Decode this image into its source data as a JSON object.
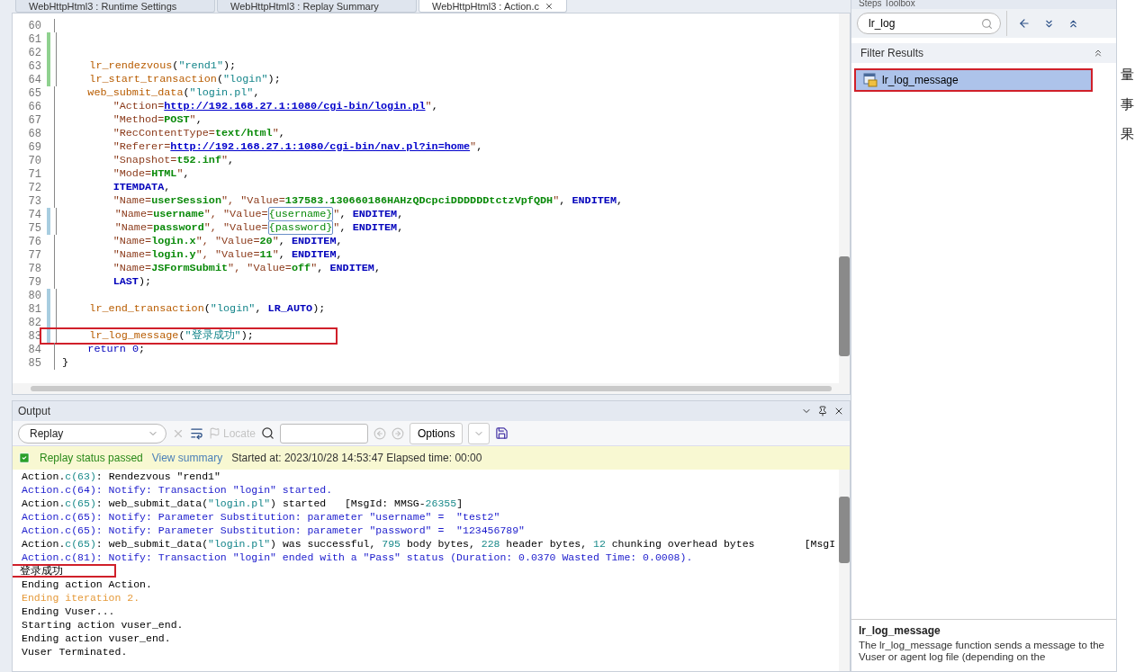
{
  "tabs": [
    {
      "label": "WebHttpHtml3 : Runtime Settings",
      "selected": false,
      "closable": false
    },
    {
      "label": "WebHttpHtml3 : Replay Summary",
      "selected": false,
      "closable": false
    },
    {
      "label": "WebHttpHtml3 : Action.c",
      "selected": true,
      "closable": true
    }
  ],
  "code": {
    "lines": [
      {
        "number": "60"
      },
      {
        "number": "61",
        "color": "#8fd18f"
      },
      {
        "number": "62",
        "color": "#8fd18f"
      },
      {
        "number": "63",
        "color": "#8fd18f",
        "tokens": [
          {
            "kind": "fn",
            "text": "    lr_rendezvous"
          },
          {
            "kind": "plain",
            "text": "("
          },
          {
            "kind": "str",
            "text": "\"rend1\""
          },
          {
            "kind": "plain",
            "text": ");"
          }
        ]
      },
      {
        "number": "64",
        "color": "#8fd18f",
        "tokens": [
          {
            "kind": "fn",
            "text": "    lr_start_transaction"
          },
          {
            "kind": "plain",
            "text": "("
          },
          {
            "kind": "str",
            "text": "\"login\""
          },
          {
            "kind": "plain",
            "text": ");"
          }
        ]
      },
      {
        "number": "65",
        "tokens": [
          {
            "kind": "fn",
            "text": "    web_submit_data"
          },
          {
            "kind": "plain",
            "text": "("
          },
          {
            "kind": "str",
            "text": "\"login.pl\""
          },
          {
            "kind": "plain",
            "text": ","
          }
        ]
      },
      {
        "number": "66",
        "tokens": [
          {
            "kind": "key",
            "text": "        \"Action="
          },
          {
            "kind": "link",
            "text": "http://192.168.27.1:1080/cgi-bin/login.pl"
          },
          {
            "kind": "key",
            "text": "\""
          },
          {
            "kind": "plain",
            "text": ","
          }
        ]
      },
      {
        "number": "67",
        "tokens": [
          {
            "kind": "key",
            "text": "        \"Method="
          },
          {
            "kind": "val",
            "text": "POST"
          },
          {
            "kind": "key",
            "text": "\""
          },
          {
            "kind": "plain",
            "text": ","
          }
        ]
      },
      {
        "number": "68",
        "tokens": [
          {
            "kind": "key",
            "text": "        \"RecContentType="
          },
          {
            "kind": "val",
            "text": "text/html"
          },
          {
            "kind": "key",
            "text": "\""
          },
          {
            "kind": "plain",
            "text": ","
          }
        ]
      },
      {
        "number": "69",
        "tokens": [
          {
            "kind": "key",
            "text": "        \"Referer="
          },
          {
            "kind": "link",
            "text": "http://192.168.27.1:1080/cgi-bin/nav.pl?in=home"
          },
          {
            "kind": "key",
            "text": "\""
          },
          {
            "kind": "plain",
            "text": ","
          }
        ]
      },
      {
        "number": "70",
        "tokens": [
          {
            "kind": "key",
            "text": "        \"Snapshot="
          },
          {
            "kind": "val",
            "text": "t52.inf"
          },
          {
            "kind": "key",
            "text": "\""
          },
          {
            "kind": "plain",
            "text": ","
          }
        ]
      },
      {
        "number": "71",
        "tokens": [
          {
            "kind": "key",
            "text": "        \"Mode="
          },
          {
            "kind": "val",
            "text": "HTML"
          },
          {
            "kind": "key",
            "text": "\""
          },
          {
            "kind": "plain",
            "text": ","
          }
        ]
      },
      {
        "number": "72",
        "tokens": [
          {
            "kind": "kw",
            "text": "        ITEMDATA"
          },
          {
            "kind": "plain",
            "text": ","
          }
        ]
      },
      {
        "number": "73",
        "tokens": [
          {
            "kind": "key",
            "text": "        \"Name="
          },
          {
            "kind": "val",
            "text": "userSession"
          },
          {
            "kind": "key",
            "text": "\", \"Value="
          },
          {
            "kind": "val",
            "text": "137583.130660186HAHzQDcpciDDDDDDtctzVpfQDH"
          },
          {
            "kind": "key",
            "text": "\""
          },
          {
            "kind": "plain",
            "text": ", "
          },
          {
            "kind": "kw",
            "text": "ENDITEM"
          },
          {
            "kind": "plain",
            "text": ","
          }
        ]
      },
      {
        "number": "74",
        "color": "#a8cde0",
        "tokens": [
          {
            "kind": "key",
            "text": "        \"Name="
          },
          {
            "kind": "val",
            "text": "username"
          },
          {
            "kind": "key",
            "text": "\", \"Value="
          },
          {
            "kind": "param",
            "text": "{username}"
          },
          {
            "kind": "key",
            "text": "\""
          },
          {
            "kind": "plain",
            "text": ", "
          },
          {
            "kind": "kw",
            "text": "ENDITEM"
          },
          {
            "kind": "plain",
            "text": ","
          }
        ]
      },
      {
        "number": "75",
        "color": "#a8cde0",
        "tokens": [
          {
            "kind": "key",
            "text": "        \"Name="
          },
          {
            "kind": "val",
            "text": "password"
          },
          {
            "kind": "key",
            "text": "\", \"Value="
          },
          {
            "kind": "param",
            "text": "{password}"
          },
          {
            "kind": "key",
            "text": "\""
          },
          {
            "kind": "plain",
            "text": ", "
          },
          {
            "kind": "kw",
            "text": "ENDITEM"
          },
          {
            "kind": "plain",
            "text": ","
          }
        ]
      },
      {
        "number": "76",
        "tokens": [
          {
            "kind": "key",
            "text": "        \"Name="
          },
          {
            "kind": "val",
            "text": "login.x"
          },
          {
            "kind": "key",
            "text": "\", \"Value="
          },
          {
            "kind": "val",
            "text": "20"
          },
          {
            "kind": "key",
            "text": "\""
          },
          {
            "kind": "plain",
            "text": ", "
          },
          {
            "kind": "kw",
            "text": "ENDITEM"
          },
          {
            "kind": "plain",
            "text": ","
          }
        ]
      },
      {
        "number": "77",
        "tokens": [
          {
            "kind": "key",
            "text": "        \"Name="
          },
          {
            "kind": "val",
            "text": "login.y"
          },
          {
            "kind": "key",
            "text": "\", \"Value="
          },
          {
            "kind": "val",
            "text": "11"
          },
          {
            "kind": "key",
            "text": "\""
          },
          {
            "kind": "plain",
            "text": ", "
          },
          {
            "kind": "kw",
            "text": "ENDITEM"
          },
          {
            "kind": "plain",
            "text": ","
          }
        ]
      },
      {
        "number": "78",
        "tokens": [
          {
            "kind": "key",
            "text": "        \"Name="
          },
          {
            "kind": "val",
            "text": "JSFormSubmit"
          },
          {
            "kind": "key",
            "text": "\", \"Value="
          },
          {
            "kind": "val",
            "text": "off"
          },
          {
            "kind": "key",
            "text": "\""
          },
          {
            "kind": "plain",
            "text": ", "
          },
          {
            "kind": "kw",
            "text": "ENDITEM"
          },
          {
            "kind": "plain",
            "text": ","
          }
        ]
      },
      {
        "number": "79",
        "tokens": [
          {
            "kind": "kw",
            "text": "        LAST"
          },
          {
            "kind": "plain",
            "text": ");"
          }
        ]
      },
      {
        "number": "80",
        "color": "#a8cde0"
      },
      {
        "number": "81",
        "color": "#a8cde0",
        "tokens": [
          {
            "kind": "fn",
            "text": "    lr_end_transaction"
          },
          {
            "kind": "plain",
            "text": "("
          },
          {
            "kind": "str",
            "text": "\"login\""
          },
          {
            "kind": "plain",
            "text": ", "
          },
          {
            "kind": "kw",
            "text": "LR_AUTO"
          },
          {
            "kind": "plain",
            "text": ");"
          }
        ]
      },
      {
        "number": "82",
        "color": "#a8cde0"
      },
      {
        "number": "83",
        "color": "#a8cde0",
        "highlighted": true,
        "tokens": [
          {
            "kind": "fn",
            "text": "    lr_log_message"
          },
          {
            "kind": "plain",
            "text": "("
          },
          {
            "kind": "str",
            "text": "\"登录成功\""
          },
          {
            "kind": "plain",
            "text": ");"
          }
        ]
      },
      {
        "number": "84",
        "tokens": [
          {
            "kind": "ret",
            "text": "    return"
          },
          {
            "kind": "ret",
            "text": " 0"
          },
          {
            "kind": "plain",
            "text": ";"
          }
        ]
      },
      {
        "number": "85",
        "tokens": [
          {
            "kind": "plain",
            "text": "}"
          }
        ]
      }
    ]
  },
  "output": {
    "title": "Output",
    "source": "Replay",
    "locate": "Locate",
    "options": "Options",
    "status": {
      "passed": true,
      "label": "Replay status passed",
      "link": "View summary",
      "info": "Started at: 2023/10/28 14:53:47 Elapsed time: 00:00"
    },
    "log": [
      {
        "segments": [
          {
            "kind": "plain",
            "text": "Action."
          },
          {
            "kind": "num",
            "text": "c(63)"
          },
          {
            "kind": "plain",
            "text": ": Rendezvous \"rend1\""
          }
        ]
      },
      {
        "segments": [
          {
            "kind": "notify",
            "text": "Action.c(64): Notify: Transaction \"login\" started."
          }
        ]
      },
      {
        "segments": [
          {
            "kind": "plain",
            "text": "Action."
          },
          {
            "kind": "num",
            "text": "c(65)"
          },
          {
            "kind": "plain",
            "text": ": web_submit_data("
          },
          {
            "kind": "str",
            "text": "\"login.pl\""
          },
          {
            "kind": "plain",
            "text": ") started   [MsgId: MMSG-"
          },
          {
            "kind": "num",
            "text": "26355"
          },
          {
            "kind": "plain",
            "text": "]"
          }
        ]
      },
      {
        "segments": [
          {
            "kind": "notify",
            "text": "Action.c(65): Notify: Parameter Substitution: parameter \"username\" =  \"test2\""
          }
        ]
      },
      {
        "segments": [
          {
            "kind": "notify",
            "text": "Action.c(65): Notify: Parameter Substitution: parameter \"password\" =  \"123456789\""
          }
        ]
      },
      {
        "segments": [
          {
            "kind": "plain",
            "text": "Action."
          },
          {
            "kind": "num",
            "text": "c(65)"
          },
          {
            "kind": "plain",
            "text": ": web_submit_data("
          },
          {
            "kind": "str",
            "text": "\"login.pl\""
          },
          {
            "kind": "plain",
            "text": ") was successful, "
          },
          {
            "kind": "num",
            "text": "795"
          },
          {
            "kind": "plain",
            "text": " body bytes, "
          },
          {
            "kind": "num",
            "text": "228"
          },
          {
            "kind": "plain",
            "text": " header bytes, "
          },
          {
            "kind": "num",
            "text": "12"
          },
          {
            "kind": "plain",
            "text": " chunking overhead bytes        [MsgI"
          }
        ]
      },
      {
        "segments": [
          {
            "kind": "notify",
            "text": "Action.c(81): Notify: Transaction \"login\" ended with a \"Pass\" status (Duration: 0.0370 Wasted Time: 0.0008)."
          }
        ]
      },
      {
        "highlighted": true,
        "segments": [
          {
            "kind": "plain",
            "text": "登录成功"
          }
        ]
      },
      {
        "highlighted": false,
        "segments": [
          {
            "kind": "plain",
            "text": "Ending action Action."
          }
        ]
      },
      {
        "segments": [
          {
            "kind": "warn",
            "text": "Ending iteration 2."
          }
        ]
      },
      {
        "segments": [
          {
            "kind": "plain",
            "text": "Ending Vuser..."
          }
        ]
      },
      {
        "segments": [
          {
            "kind": "plain",
            "text": "Starting action vuser_end."
          }
        ]
      },
      {
        "segments": [
          {
            "kind": "plain",
            "text": "Ending action vuser_end."
          }
        ]
      },
      {
        "segments": [
          {
            "kind": "plain",
            "text": "Vuser Terminated."
          }
        ]
      }
    ]
  },
  "steps_toolbox": {
    "title": "Steps Toolbox",
    "search": "lr_log",
    "section": "Filter Results",
    "results": [
      {
        "label": "lr_log_message",
        "selected": true,
        "highlighted": true
      }
    ],
    "help": {
      "title": "lr_log_message",
      "text": "The lr_log_message function sends a message to the Vuser or agent log file (depending on the"
    }
  },
  "background_text": [
    "量",
    "事",
    "果"
  ]
}
